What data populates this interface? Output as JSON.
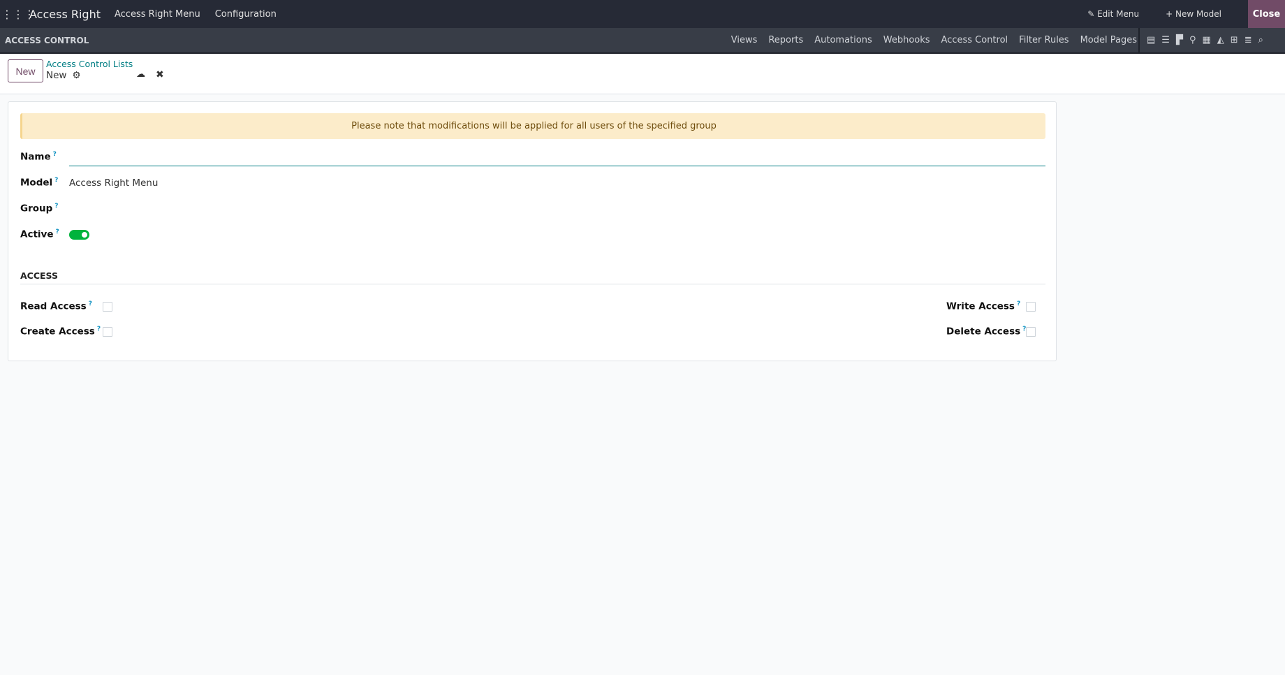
{
  "topbar": {
    "app_title": "Access Right",
    "menus": [
      "Access Right Menu",
      "Configuration"
    ],
    "edit_menu": "Edit Menu",
    "new_model": "New Model",
    "close": "Close"
  },
  "subbar": {
    "title": "ACCESS CONTROL",
    "nav": [
      "Views",
      "Reports",
      "Automations",
      "Webhooks",
      "Access Control",
      "Filter Rules",
      "Model Pages"
    ],
    "view_icons": [
      "form-view-icon",
      "list-view-icon",
      "kanban-view-icon",
      "map-view-icon",
      "calendar-view-icon",
      "graph-view-icon",
      "pivot-view-icon",
      "activity-view-icon",
      "search-icon"
    ]
  },
  "control_panel": {
    "new_button": "New",
    "breadcrumb": "Access Control Lists",
    "record": "New"
  },
  "form": {
    "alert": "Please note that modifications will be applied for all users of the specified group",
    "name_label": "Name",
    "name_value": "",
    "model_label": "Model",
    "model_value": "Access Right Menu",
    "group_label": "Group",
    "active_label": "Active",
    "active": true,
    "section_title": "ACCESS",
    "read_label": "Read Access",
    "read": false,
    "create_label": "Create Access",
    "create": false,
    "write_label": "Write Access",
    "write": false,
    "delete_label": "Delete Access",
    "delete": false,
    "help": "?"
  }
}
